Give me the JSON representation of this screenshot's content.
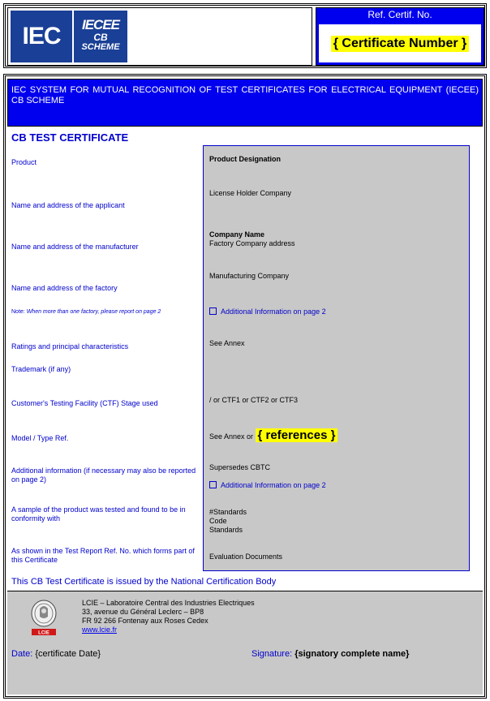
{
  "header": {
    "logo_iec": "IEC",
    "logo_iecee_line1": "IECEE",
    "logo_iecee_line2": "CB",
    "logo_iecee_line3": "SCHEME",
    "ref_label": "Ref. Certif. No.",
    "certificate_number": "{ Certificate Number }"
  },
  "title": "IEC SYSTEM FOR MUTUAL RECOGNITION OF TEST CERTIFICATES FOR ELECTRICAL EQUIPMENT (IECEE) CB SCHEME",
  "cb_title": "CB TEST CERTIFICATE",
  "labels": {
    "product": "Product",
    "applicant": "Name and address of the applicant",
    "manufacturer": "Name and address of the manufacturer",
    "factory": "Name and address of the factory",
    "note_prefix": "Note: ",
    "note_text": "When more than one factory, please report on page 2",
    "ratings": "Ratings and principal characteristics",
    "trademark": "Trademark (if any)",
    "ctf": "Customer's Testing Facility (CTF) Stage used",
    "model": "Model / Type Ref.",
    "additional": "Additional information (if necessary may also be reported on page 2)",
    "sample": "A sample of the product was tested and found to be in conformity with",
    "shown": "As shown in the Test Report Ref. No. which forms part of this Certificate"
  },
  "values": {
    "product_designation": "Product Designation",
    "license_holder": "License Holder Company",
    "company_name": "Company Name",
    "factory_address": "Factory Company address",
    "manufacturing_company": "Manufacturing Company",
    "additional_info_1": "Additional Information on page 2",
    "see_annex": "See Annex",
    "ctf_value": "/ or CTF1 or CTF2 or CTF3",
    "model_prefix": "See Annex or ",
    "references": "{ references }",
    "supersedes": "Supersedes CBTC",
    "additional_info_2": "Additional Information on page 2",
    "standards_1": "#Standards",
    "standards_2": "Code",
    "standards_3": "Standards",
    "evaluation": "Evaluation Documents"
  },
  "issued": "This CB Test Certificate is issued by the National Certification Body",
  "ncb": {
    "line1": "LCIE – Laboratoire Central des Industries Electriques",
    "line2": "33, avenue du Général Leclerc – BP8",
    "line3": "FR 92 266 Fontenay aux Roses Cedex",
    "link": "www.lcie.fr",
    "seal_text": "LCIE"
  },
  "footer": {
    "date_label": "Date:",
    "date_value": "{certificate Date}",
    "signature_label": "Signature:",
    "signature_value": "{signatory complete name}"
  }
}
